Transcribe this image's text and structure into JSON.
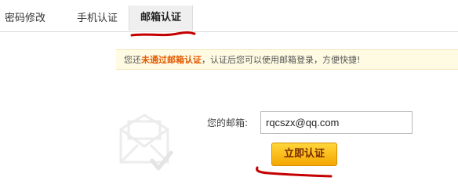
{
  "tabs": [
    {
      "label": "密码修改"
    },
    {
      "label": "手机认证"
    },
    {
      "label": "邮箱认证"
    }
  ],
  "notice": {
    "prefix": "您还",
    "highlight": "未通过邮箱认证",
    "suffix": "，认证后您可以使用邮箱登录，方便快捷!"
  },
  "form": {
    "email_label": "您的邮箱:",
    "email_value": "rqcszx@qq.com",
    "submit_label": "立即认证"
  },
  "colors": {
    "annotation": "#c40000",
    "notice_highlight": "#e35a00",
    "button_top": "#ffd63a",
    "button_bottom": "#f5a600"
  },
  "icons": {
    "envelope": "envelope-illustration-icon"
  }
}
